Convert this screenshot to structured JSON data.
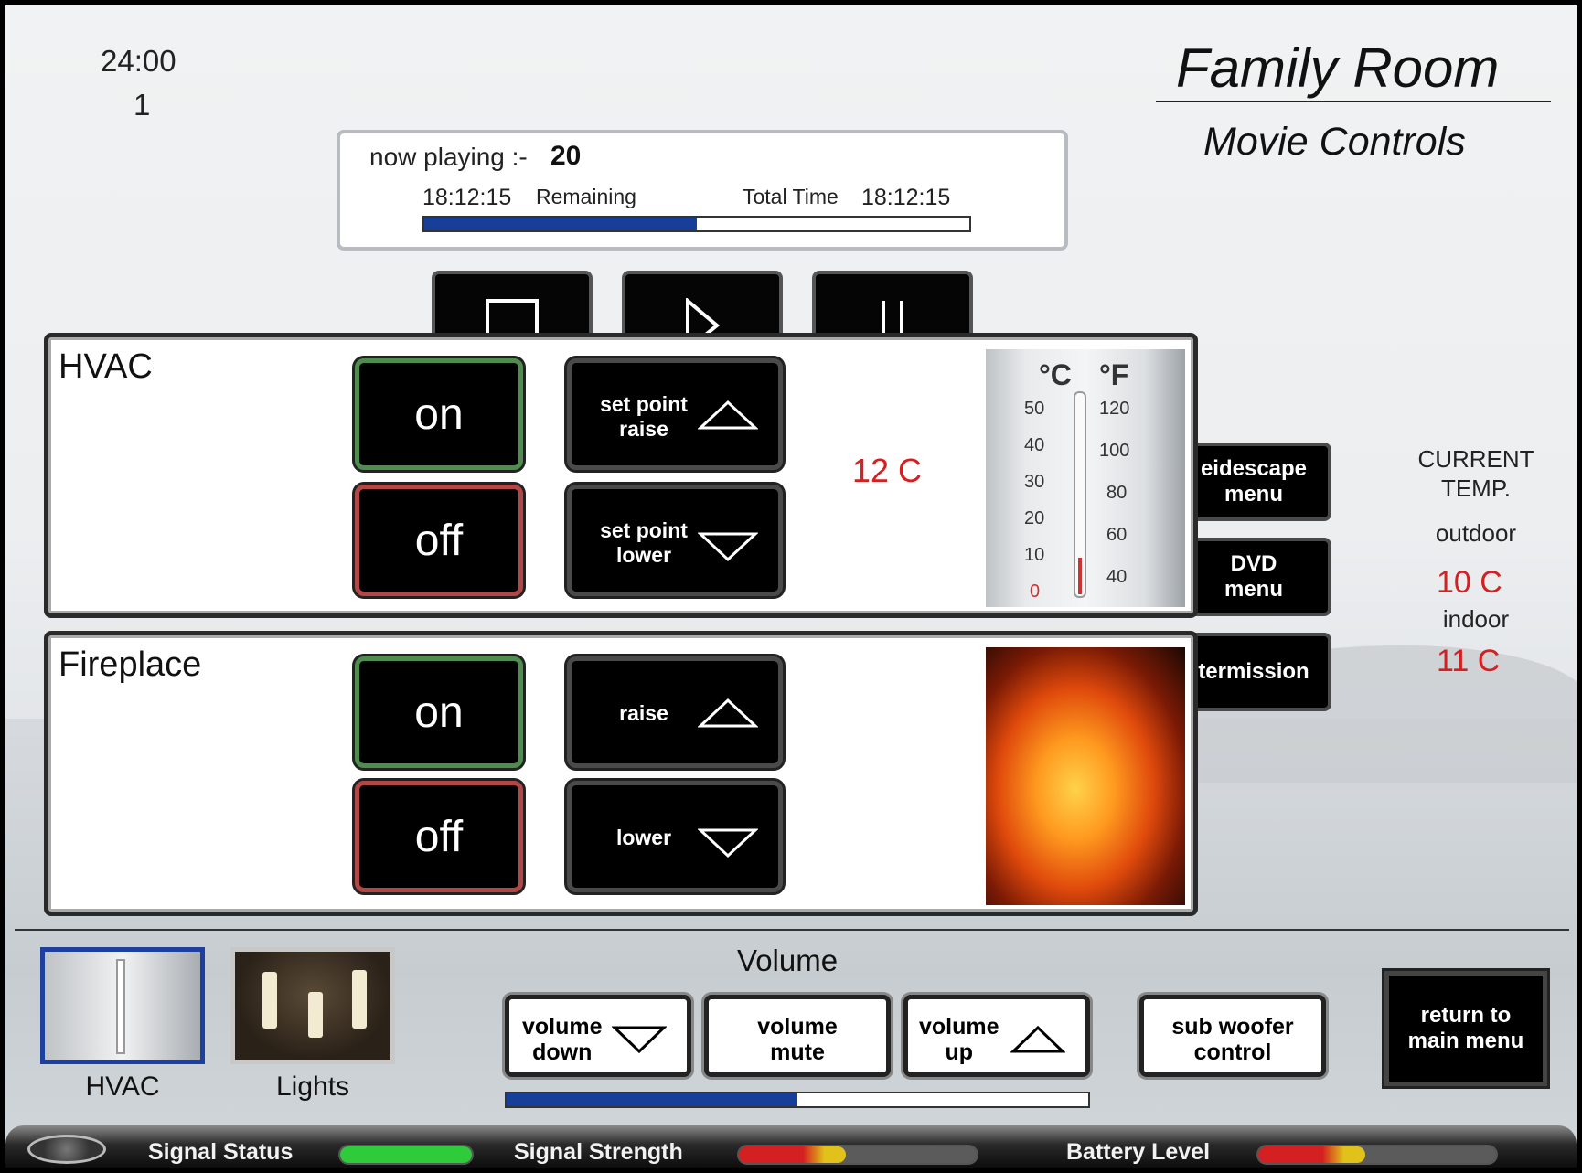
{
  "header": {
    "clock": "24:00",
    "clock_sub": "1",
    "room_title": "Family Room",
    "subtitle": "Movie Controls"
  },
  "now_playing": {
    "label": "now playing :-",
    "track": "20",
    "remaining_time": "18:12:15",
    "remaining_label": "Remaining",
    "total_label": "Total Time",
    "total_time": "18:12:15",
    "progress_percent": 50
  },
  "transport": {
    "icons": [
      "stop-icon",
      "play-icon",
      "pause-icon"
    ]
  },
  "side_menu": {
    "items": [
      "eidescape\nmenu",
      "DVD\nmenu",
      "termission"
    ]
  },
  "current_temp": {
    "heading": "CURRENT\nTEMP.",
    "outdoor_label": "outdoor",
    "outdoor_value": "10  C",
    "indoor_label": "indoor",
    "indoor_value": "11  C"
  },
  "hvac": {
    "title": "HVAC",
    "on_label": "on",
    "off_label": "off",
    "raise_label": "set point\nraise",
    "lower_label": "set point\nlower",
    "setpoint": "12  C",
    "thermometer": {
      "unit_c": "°C",
      "unit_f": "°F",
      "c_ticks": [
        "50",
        "40",
        "30",
        "20",
        "10",
        "0"
      ],
      "f_ticks": [
        "120",
        "100",
        "80",
        "60",
        "40"
      ]
    }
  },
  "fireplace": {
    "title": "Fireplace",
    "on_label": "on",
    "off_label": "off",
    "raise_label": "raise",
    "lower_label": "lower"
  },
  "bottom": {
    "thumbs": [
      {
        "label": "HVAC",
        "selected": true
      },
      {
        "label": "Lights",
        "selected": false
      }
    ],
    "volume_title": "Volume",
    "volume_down": "volume\ndown",
    "volume_mute": "volume\nmute",
    "volume_up": "volume\nup",
    "sub_woofer": "sub woofer\ncontrol",
    "volume_percent": 50,
    "return_label": "return to\nmain menu"
  },
  "status": {
    "signal_status": "Signal Status",
    "signal_strength": "Signal Strength",
    "battery_level": "Battery Level",
    "signal_status_color": "#2ecc3a",
    "signal_strength_percent": 45,
    "battery_level_percent": 45
  }
}
